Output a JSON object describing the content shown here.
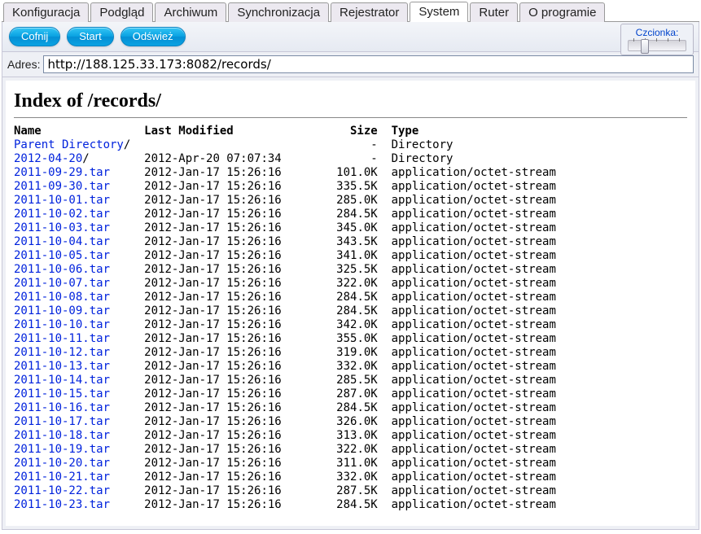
{
  "tabs": {
    "items": [
      "Konfiguracja",
      "Podgląd",
      "Archiwum",
      "Synchronizacja",
      "Rejestrator",
      "System",
      "Ruter",
      "O programie"
    ],
    "activeIndex": 5
  },
  "toolbar": {
    "back": "Cofnij",
    "start": "Start",
    "refresh": "Odśwież",
    "font_legend": "Czcionka:"
  },
  "address": {
    "label": "Adres:",
    "value": "http://188.125.33.173:8082/records/"
  },
  "page": {
    "title": "Index of /records/",
    "columns": {
      "name": "Name",
      "modified": "Last Modified",
      "size": "Size",
      "type": "Type"
    },
    "entries": [
      {
        "name": "Parent Directory",
        "suffix": "/",
        "modified": "",
        "size": "-",
        "type": "Directory",
        "link": true
      },
      {
        "name": "2012-04-20",
        "suffix": "/",
        "modified": "2012-Apr-20 07:07:34",
        "size": "-",
        "type": "Directory",
        "link": true
      },
      {
        "name": "2011-09-29.tar",
        "suffix": "",
        "modified": "2012-Jan-17 15:26:16",
        "size": "101.0K",
        "type": "application/octet-stream",
        "link": true
      },
      {
        "name": "2011-09-30.tar",
        "suffix": "",
        "modified": "2012-Jan-17 15:26:16",
        "size": "335.5K",
        "type": "application/octet-stream",
        "link": true
      },
      {
        "name": "2011-10-01.tar",
        "suffix": "",
        "modified": "2012-Jan-17 15:26:16",
        "size": "285.0K",
        "type": "application/octet-stream",
        "link": true
      },
      {
        "name": "2011-10-02.tar",
        "suffix": "",
        "modified": "2012-Jan-17 15:26:16",
        "size": "284.5K",
        "type": "application/octet-stream",
        "link": true
      },
      {
        "name": "2011-10-03.tar",
        "suffix": "",
        "modified": "2012-Jan-17 15:26:16",
        "size": "345.0K",
        "type": "application/octet-stream",
        "link": true
      },
      {
        "name": "2011-10-04.tar",
        "suffix": "",
        "modified": "2012-Jan-17 15:26:16",
        "size": "343.5K",
        "type": "application/octet-stream",
        "link": true
      },
      {
        "name": "2011-10-05.tar",
        "suffix": "",
        "modified": "2012-Jan-17 15:26:16",
        "size": "341.0K",
        "type": "application/octet-stream",
        "link": true
      },
      {
        "name": "2011-10-06.tar",
        "suffix": "",
        "modified": "2012-Jan-17 15:26:16",
        "size": "325.5K",
        "type": "application/octet-stream",
        "link": true
      },
      {
        "name": "2011-10-07.tar",
        "suffix": "",
        "modified": "2012-Jan-17 15:26:16",
        "size": "322.0K",
        "type": "application/octet-stream",
        "link": true
      },
      {
        "name": "2011-10-08.tar",
        "suffix": "",
        "modified": "2012-Jan-17 15:26:16",
        "size": "284.5K",
        "type": "application/octet-stream",
        "link": true
      },
      {
        "name": "2011-10-09.tar",
        "suffix": "",
        "modified": "2012-Jan-17 15:26:16",
        "size": "284.5K",
        "type": "application/octet-stream",
        "link": true
      },
      {
        "name": "2011-10-10.tar",
        "suffix": "",
        "modified": "2012-Jan-17 15:26:16",
        "size": "342.0K",
        "type": "application/octet-stream",
        "link": true
      },
      {
        "name": "2011-10-11.tar",
        "suffix": "",
        "modified": "2012-Jan-17 15:26:16",
        "size": "355.0K",
        "type": "application/octet-stream",
        "link": true
      },
      {
        "name": "2011-10-12.tar",
        "suffix": "",
        "modified": "2012-Jan-17 15:26:16",
        "size": "319.0K",
        "type": "application/octet-stream",
        "link": true
      },
      {
        "name": "2011-10-13.tar",
        "suffix": "",
        "modified": "2012-Jan-17 15:26:16",
        "size": "332.0K",
        "type": "application/octet-stream",
        "link": true
      },
      {
        "name": "2011-10-14.tar",
        "suffix": "",
        "modified": "2012-Jan-17 15:26:16",
        "size": "285.5K",
        "type": "application/octet-stream",
        "link": true
      },
      {
        "name": "2011-10-15.tar",
        "suffix": "",
        "modified": "2012-Jan-17 15:26:16",
        "size": "287.0K",
        "type": "application/octet-stream",
        "link": true
      },
      {
        "name": "2011-10-16.tar",
        "suffix": "",
        "modified": "2012-Jan-17 15:26:16",
        "size": "284.5K",
        "type": "application/octet-stream",
        "link": true
      },
      {
        "name": "2011-10-17.tar",
        "suffix": "",
        "modified": "2012-Jan-17 15:26:16",
        "size": "326.0K",
        "type": "application/octet-stream",
        "link": true
      },
      {
        "name": "2011-10-18.tar",
        "suffix": "",
        "modified": "2012-Jan-17 15:26:16",
        "size": "313.0K",
        "type": "application/octet-stream",
        "link": true
      },
      {
        "name": "2011-10-19.tar",
        "suffix": "",
        "modified": "2012-Jan-17 15:26:16",
        "size": "322.0K",
        "type": "application/octet-stream",
        "link": true
      },
      {
        "name": "2011-10-20.tar",
        "suffix": "",
        "modified": "2012-Jan-17 15:26:16",
        "size": "311.0K",
        "type": "application/octet-stream",
        "link": true
      },
      {
        "name": "2011-10-21.tar",
        "suffix": "",
        "modified": "2012-Jan-17 15:26:16",
        "size": "332.0K",
        "type": "application/octet-stream",
        "link": true
      },
      {
        "name": "2011-10-22.tar",
        "suffix": "",
        "modified": "2012-Jan-17 15:26:16",
        "size": "287.5K",
        "type": "application/octet-stream",
        "link": true
      },
      {
        "name": "2011-10-23.tar",
        "suffix": "",
        "modified": "2012-Jan-17 15:26:16",
        "size": "284.5K",
        "type": "application/octet-stream",
        "link": true
      }
    ]
  }
}
